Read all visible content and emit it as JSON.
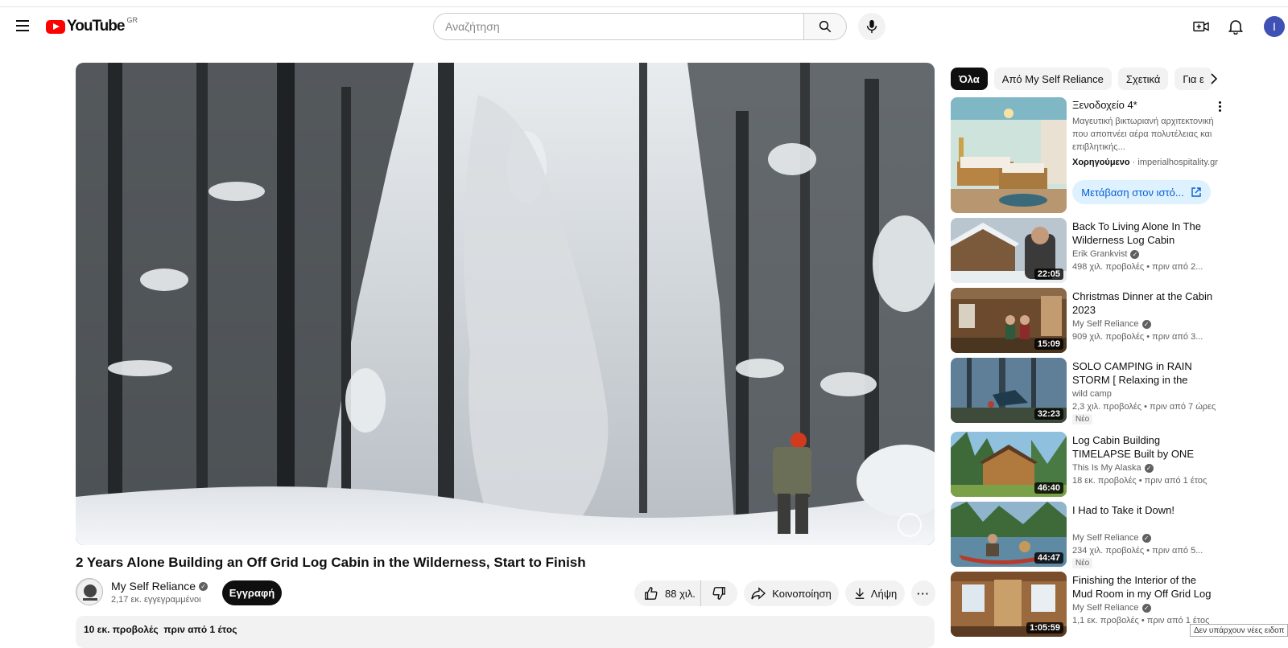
{
  "header": {
    "logo_text": "YouTube",
    "country_code": "GR",
    "search_placeholder": "Αναζήτηση",
    "avatar_initial": "I"
  },
  "video": {
    "title": "2 Years Alone Building an Off Grid Log Cabin in the Wilderness, Start to Finish",
    "channel": "My Self Reliance",
    "subscribers": "2,17 εκ. εγγεγραμμένοι",
    "subscribe_label": "Εγγραφή",
    "likes": "88 χιλ.",
    "share_label": "Κοινοποίηση",
    "download_label": "Λήψη",
    "views_and_date": "10 εκ. προβολές  πριν από 1 έτος"
  },
  "sidebar": {
    "chips": [
      "Όλα",
      "Από My Self Reliance",
      "Σχετικά",
      "Για ε"
    ],
    "ad": {
      "title": "Ξενοδοχείο 4*",
      "description": "Μαγευτική βικτωριανή αρχιτεκτονική που αποπνέει αέρα πολυτέλειας και επιβλητικής...",
      "sponsored_label": "Χορηγούμενο",
      "domain": "imperialhospitality.gr",
      "cta_label": "Μετάβαση στον ιστό..."
    },
    "recommendations": [
      {
        "title": "Back To Living Alone In The Wilderness Log Cabin",
        "channel": "Erik Grankvist",
        "meta": "498 χιλ. προβολές  • πριν από 2...",
        "duration": "22:05",
        "badge": ""
      },
      {
        "title": "Christmas Dinner at the Cabin 2023",
        "channel": "My Self Reliance",
        "meta": "909 χιλ. προβολές  • πριν από 3...",
        "duration": "15:09",
        "badge": ""
      },
      {
        "title": "SOLO CAMPING in RAIN STORM [ Relaxing in the Tarp...",
        "channel": "wild camp",
        "meta": "2,3 χιλ. προβολές  • πριν από 7 ώρες",
        "duration": "32:23",
        "badge": "Νέο"
      },
      {
        "title": "Log Cabin Building TIMELAPSE Built by ONE MAN (and...",
        "channel": "This Is My Alaska",
        "meta": "18 εκ. προβολές  • πριν από 1 έτος",
        "duration": "46:40",
        "badge": ""
      },
      {
        "title": "I Had to Take it Down!",
        "channel": "My Self Reliance",
        "meta": "234 χιλ. προβολές  • πριν από 5...",
        "duration": "44:47",
        "badge": "Νέο"
      },
      {
        "title": "Finishing the Interior of the Mud Room in my Off Grid Log Cabi...",
        "channel": "My Self Reliance",
        "meta": "1,1 εκ. προβολές  • πριν από 1 έτος",
        "duration": "1:05:59",
        "badge": ""
      }
    ]
  },
  "toast": "Δεν υπάρχουν νέες ειδοπ",
  "colors": {
    "brand_red": "#ff0000",
    "subscribe_bg": "#0f0f0f",
    "cta_bg": "#def1ff",
    "cta_text": "#065fd4"
  }
}
